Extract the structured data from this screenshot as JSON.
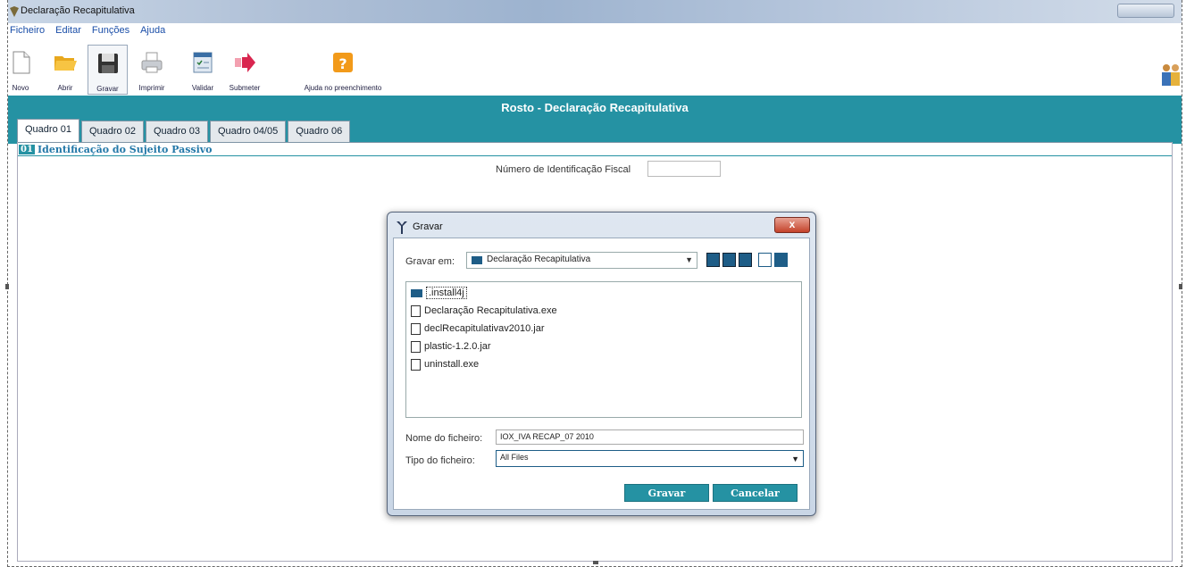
{
  "window": {
    "title": "Declaração Recapitulativa"
  },
  "menu": [
    "Ficheiro",
    "Editar",
    "Funções",
    "Ajuda"
  ],
  "toolbar": {
    "novo": "Novo",
    "abrir": "Abrir",
    "gravar": "Gravar",
    "imprimir": "Imprimir",
    "validar": "Validar",
    "submeter": "Submeter",
    "ajuda": "Ajuda no preenchimento"
  },
  "header": {
    "title": "Rosto - Declaração Recapitulativa"
  },
  "tabs": [
    "Quadro 01",
    "Quadro 02",
    "Quadro 03",
    "Quadro 04/05",
    "Quadro 06"
  ],
  "section": {
    "number": "01",
    "title": "Identificação do Sujeito Passivo"
  },
  "nif": {
    "label": "Número de Identificação Fiscal",
    "value": ""
  },
  "dialog": {
    "title": "Gravar",
    "save_in_label": "Gravar em:",
    "save_in_value": "Declaração Recapitulativa",
    "files": [
      {
        "name": ".install4j",
        "type": "folder"
      },
      {
        "name": "Declaração Recapitulativa.exe",
        "type": "file"
      },
      {
        "name": "declRecapitulativav2010.jar",
        "type": "file"
      },
      {
        "name": "plastic-1.2.0.jar",
        "type": "file"
      },
      {
        "name": "uninstall.exe",
        "type": "file"
      }
    ],
    "filename_label": "Nome do ficheiro:",
    "filename_value": "IOX_IVA RECAP_07 2010",
    "filetype_label": "Tipo do ficheiro:",
    "filetype_value": "All Files",
    "save_button": "Gravar",
    "cancel_button": "Cancelar",
    "close_glyph": "x"
  },
  "colors": {
    "accent": "#2592a3",
    "dark_blue": "#1e5d87"
  }
}
